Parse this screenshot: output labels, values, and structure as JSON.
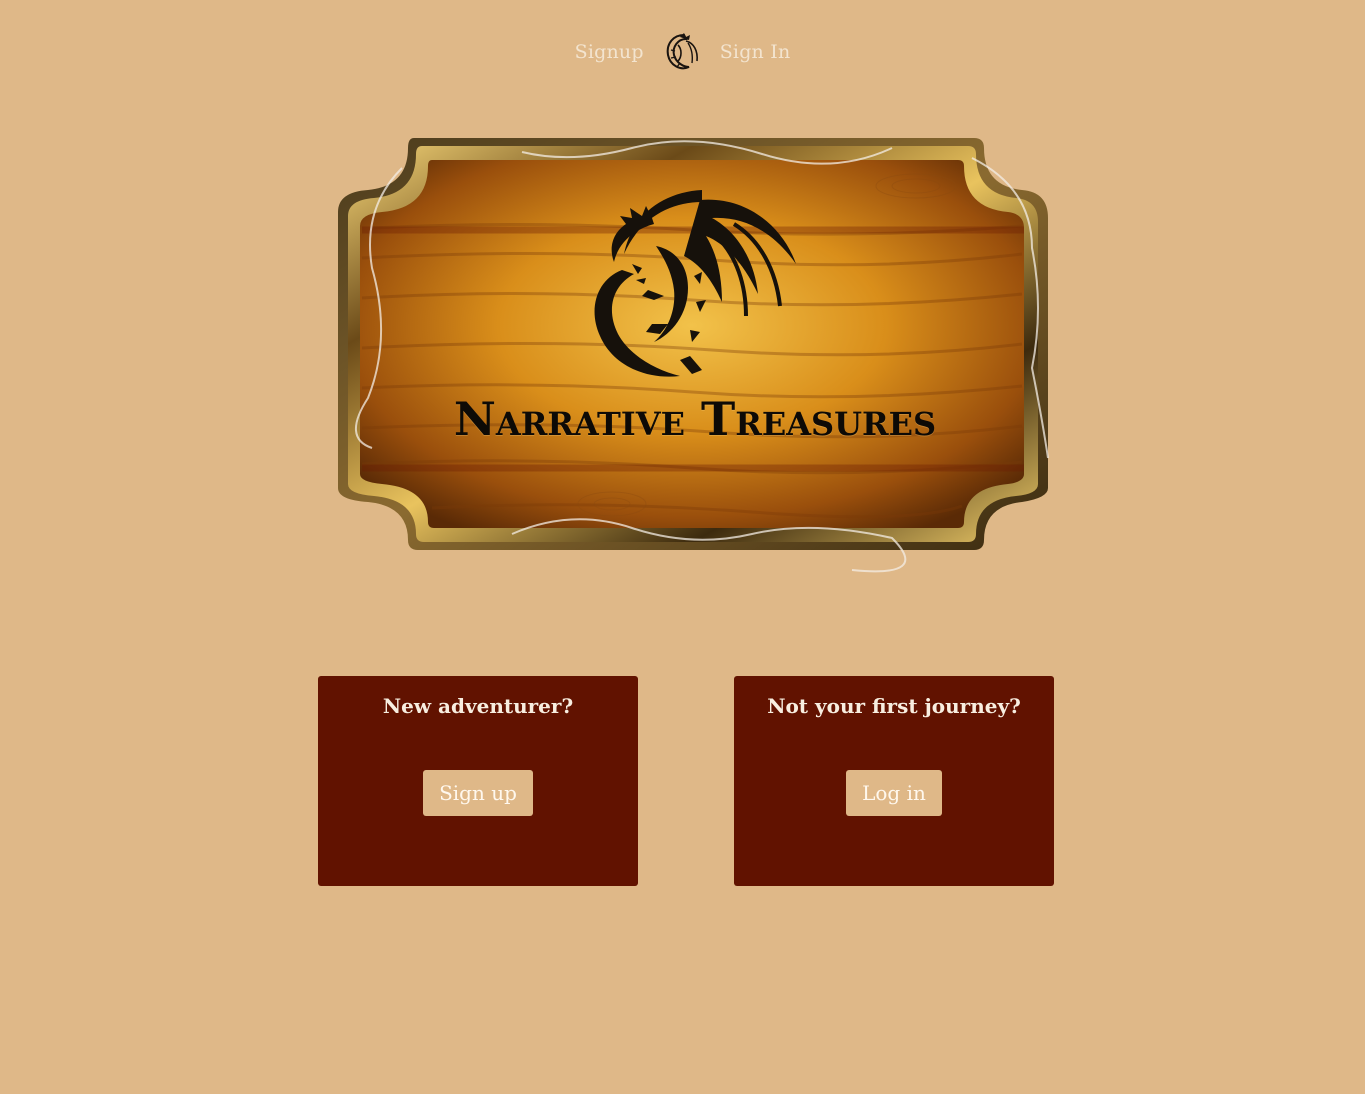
{
  "nav": {
    "signup_label": "Signup",
    "signin_label": "Sign In",
    "logo_icon": "dragon-icon"
  },
  "hero": {
    "title": "Narrative Treasures",
    "emblem_icon": "dragon-icon"
  },
  "cards": {
    "new": {
      "heading": "New adventurer?",
      "button_label": "Sign up"
    },
    "returning": {
      "heading": "Not your first journey?",
      "button_label": "Log in"
    }
  },
  "colors": {
    "background": "#dfb888",
    "card": "#611200",
    "nav_text": "#f3e4cf",
    "button": "#dfb888"
  }
}
